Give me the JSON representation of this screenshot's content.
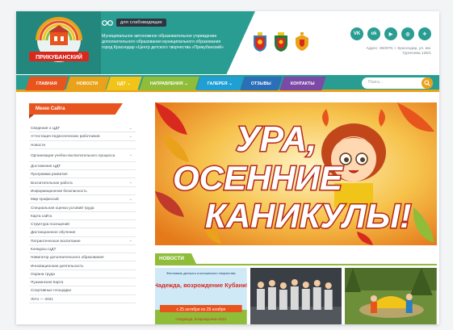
{
  "header": {
    "logo_text": "ПРИКУБАНСКИЙ",
    "eye_label": "для слабовидящих",
    "org_text": "Муниципальное автономное образовательное учреждение дополнительного образования муниципального образования город Краснодар «Центр детского творчества «Прикубанский»",
    "address": "Адрес: 350078, г. Краснодар, ул. им. Тургенева 135/1",
    "socials": [
      {
        "icon": "vk-icon",
        "glyph": "VK"
      },
      {
        "icon": "ok-icon",
        "glyph": "ok"
      },
      {
        "icon": "youtube-icon",
        "glyph": "▶"
      },
      {
        "icon": "instagram-icon",
        "glyph": "◎"
      },
      {
        "icon": "telegram-icon",
        "glyph": "✈"
      }
    ]
  },
  "nav": {
    "items": [
      {
        "label": "ГЛАВНАЯ",
        "color": "#e8541e",
        "has_dropdown": false
      },
      {
        "label": "НОВОСТИ",
        "color": "#e9a21a",
        "has_dropdown": false
      },
      {
        "label": "ЦДТ",
        "color": "#f0c419",
        "has_dropdown": true
      },
      {
        "label": "НАПРАВЛЕНИЯ",
        "color": "#8fbd3a",
        "has_dropdown": true
      },
      {
        "label": "ГАЛЕРЕЯ",
        "color": "#1f9fd4",
        "has_dropdown": true
      },
      {
        "label": "ОТЗЫВЫ",
        "color": "#2a6fb8",
        "has_dropdown": false
      },
      {
        "label": "КОНТАКТЫ",
        "color": "#7b4aa6",
        "has_dropdown": false
      }
    ],
    "search_placeholder": "Поиск..."
  },
  "sidebar": {
    "title": "Меню Сайта",
    "items": [
      {
        "label": "Сведения о ЦДТ",
        "expand": true
      },
      {
        "label": "Аттестация педагогических работников",
        "expand": true
      },
      {
        "label": "Новости",
        "expand": false
      },
      {
        "label": "Организация учебно-воспитательного процесса",
        "expand": true,
        "tall": true
      },
      {
        "label": "Достижения ЦДТ",
        "expand": false
      },
      {
        "label": "Программа развития",
        "expand": false
      },
      {
        "label": "Воспитательная работа",
        "expand": true
      },
      {
        "label": "Информационная безопасность",
        "expand": false
      },
      {
        "label": "Мир профессий",
        "expand": true
      },
      {
        "label": "Специальная оценка условий труда",
        "expand": false
      },
      {
        "label": "Карта сайта",
        "expand": false
      },
      {
        "label": "Структура посещений",
        "expand": false
      },
      {
        "label": "Дистанционное обучение",
        "expand": false
      },
      {
        "label": "Патриотическое воспитание",
        "expand": true
      },
      {
        "label": "Конкурсы ЦДТ",
        "expand": false
      },
      {
        "label": "Навигатор дополнительного образования",
        "expand": false
      },
      {
        "label": "Инновационная деятельность",
        "expand": false
      },
      {
        "label": "Охрана труда",
        "expand": false
      },
      {
        "label": "Пушкинская Карта",
        "expand": false
      },
      {
        "label": "Спортивные площадки",
        "expand": false
      },
      {
        "label": "Лето — 2021",
        "expand": false
      }
    ]
  },
  "banner": {
    "line1": "УРА,",
    "line2": "ОСЕННИЕ",
    "line3": "КАНИКУЛЫ!"
  },
  "news": {
    "title": "НОВОСТИ",
    "thumbs": [
      {
        "caption_top": "Фестиваль детского и юношеского творчества",
        "headline": "«Надежда, возрождение Кубани!»",
        "dates": "с 25 октября по 29 ноября",
        "footer": "«Надежда, возрождение»2021"
      },
      {
        "caption_top": ""
      },
      {
        "caption_top": ""
      }
    ]
  }
}
